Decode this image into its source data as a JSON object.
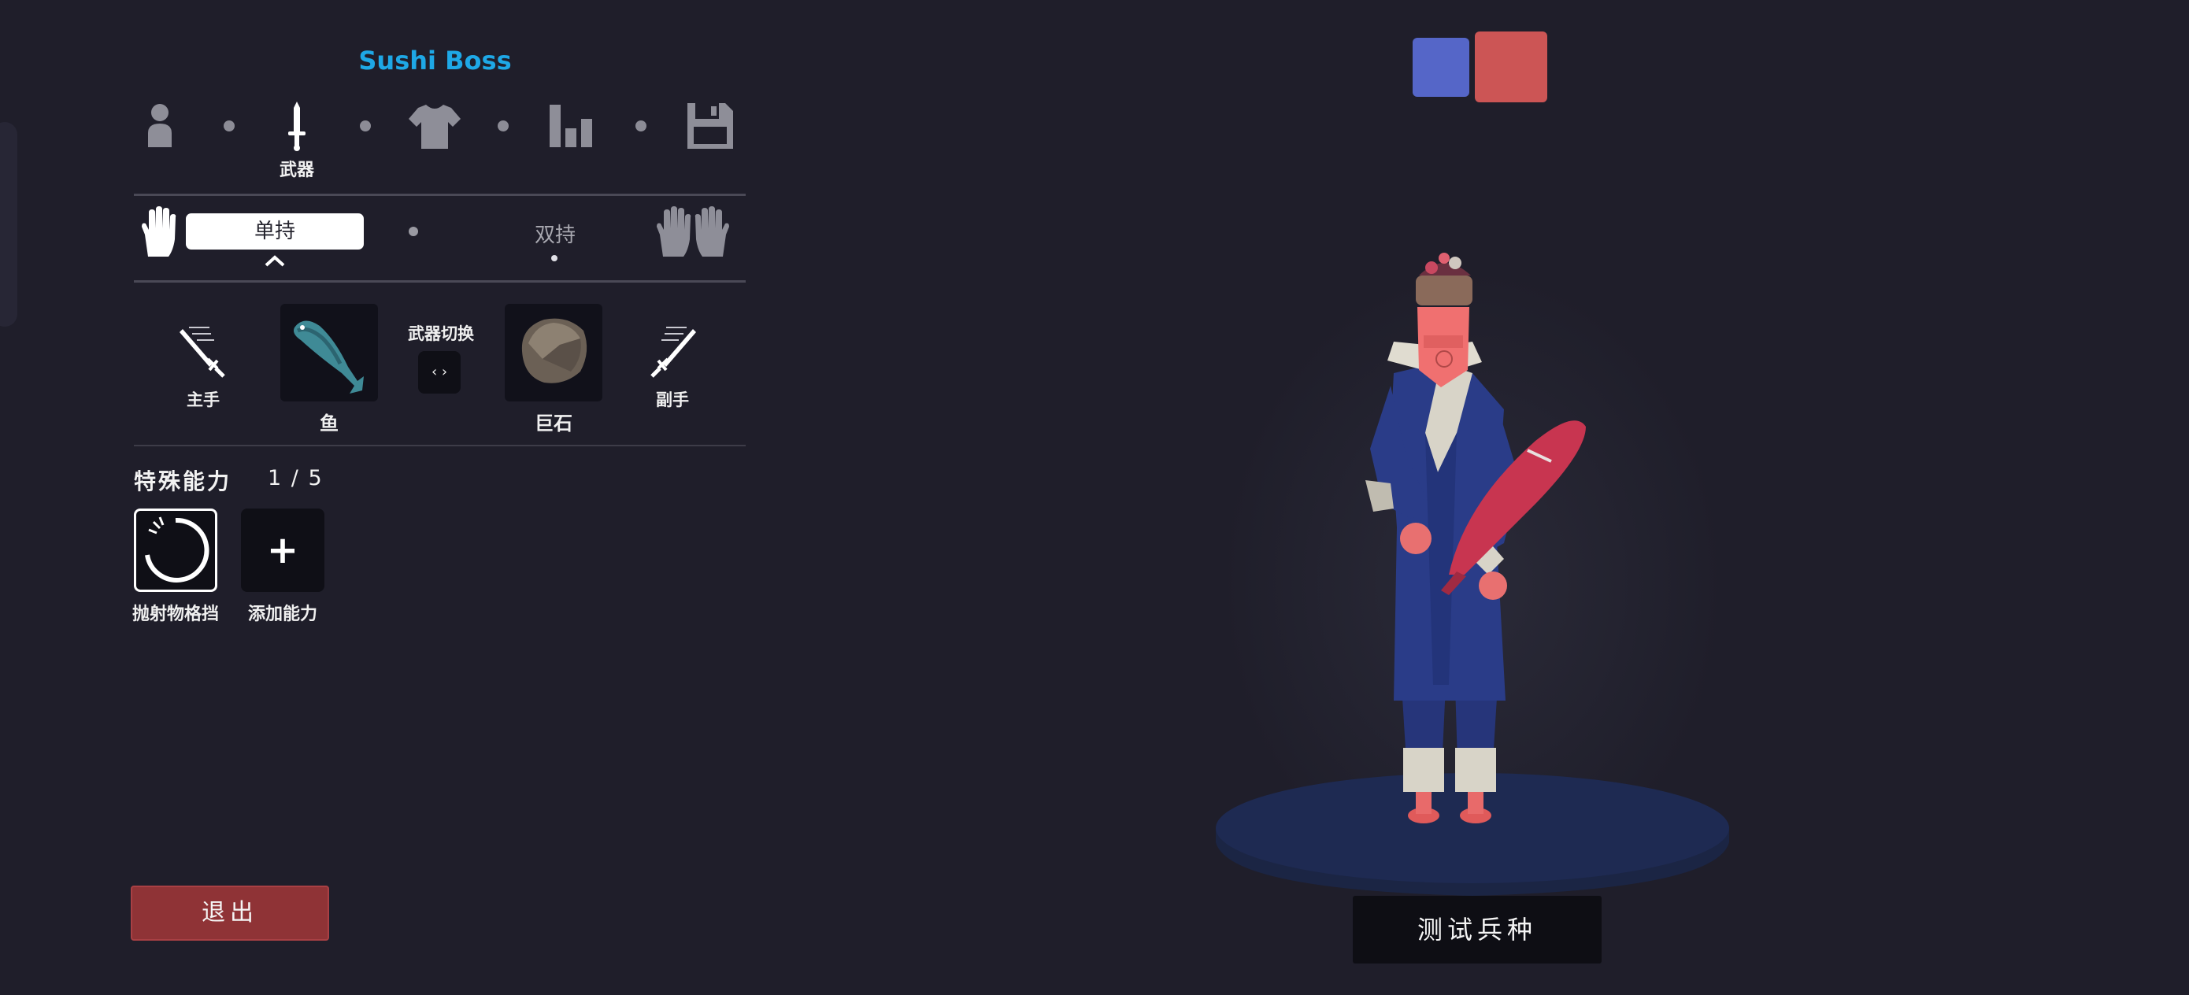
{
  "unit": {
    "name": "Sushi Boss"
  },
  "steps": [
    {
      "icon": "unit-body-icon",
      "label": ""
    },
    {
      "icon": "sword-icon",
      "label": "武器",
      "active": true
    },
    {
      "icon": "shirt-icon",
      "label": ""
    },
    {
      "icon": "stats-chart-icon",
      "label": ""
    },
    {
      "icon": "save-disk-icon",
      "label": ""
    }
  ],
  "grip": {
    "single": "单持",
    "dual": "双持",
    "single_icon": "one-hand-icon",
    "dual_icon": "two-hands-icon"
  },
  "weapons": {
    "main_hand_label": "主手",
    "off_hand_label": "副手",
    "main_weapon": "鱼",
    "off_weapon": "巨石",
    "switch_title": "武器切换",
    "switch_symbol": "‹ ›"
  },
  "abilities": {
    "title": "特殊能力",
    "count": "1 / 5",
    "items": [
      {
        "label": "抛射物格挡",
        "icon": "projectile-block-icon"
      }
    ],
    "add_label": "添加能力",
    "add_symbol": "+"
  },
  "buttons": {
    "exit": "退出",
    "test": "测试兵种"
  },
  "colors": {
    "accent": "#1ea8e6",
    "team_blue": "#5566c8",
    "team_red": "#cc5555",
    "exit": "#8f3336"
  }
}
